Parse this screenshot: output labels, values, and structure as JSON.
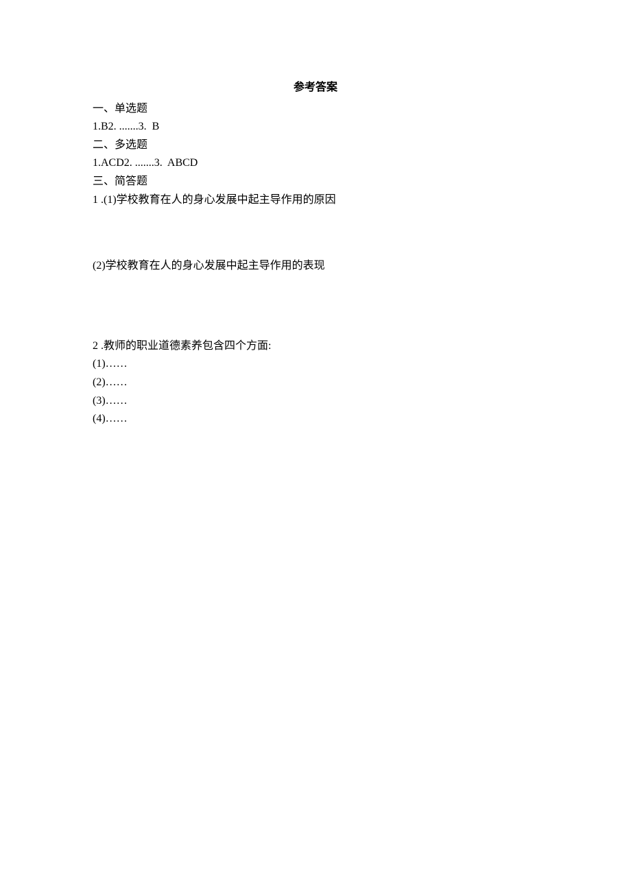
{
  "title": "参考答案",
  "sections": {
    "s1": {
      "heading": "一、单选题",
      "line": "1.B2. .......3.  B"
    },
    "s2": {
      "heading": "二、多选题",
      "line": "1.ACD2. .......3.  ABCD"
    },
    "s3": {
      "heading": "三、简答题",
      "q1": {
        "intro": "1 .(1)学校教育在人的身心发展中起主导作用的原因",
        "part2": "(2)学校教育在人的身心发展中起主导作用的表现"
      },
      "q2": {
        "intro": "2 .教师的职业道德素养包含四个方面:",
        "i1": "(1)……",
        "i2": "(2)……",
        "i3": "(3)……",
        "i4": "(4)……"
      }
    }
  }
}
